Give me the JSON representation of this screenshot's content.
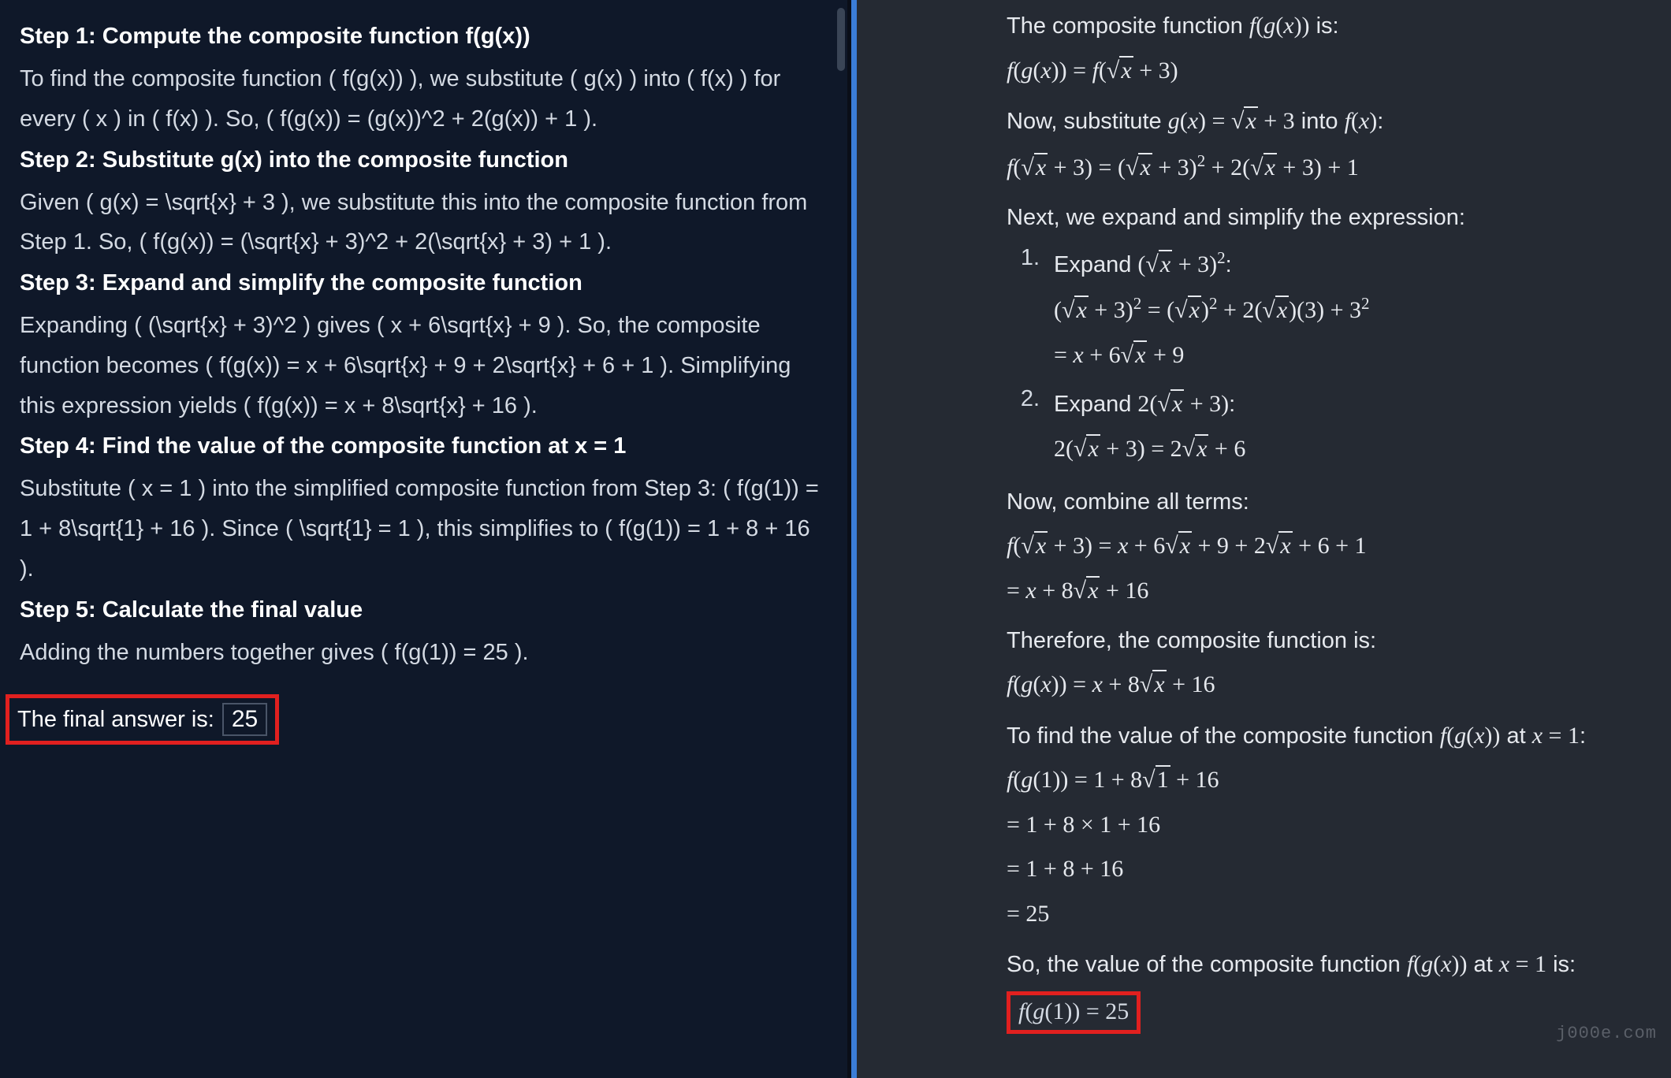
{
  "left": {
    "steps": [
      {
        "title": "Step 1: Compute the composite function f(g(x))",
        "body": "To find the composite function ( f(g(x)) ), we substitute ( g(x) ) into ( f(x) ) for every ( x ) in ( f(x) ). So, ( f(g(x)) = (g(x))^2 + 2(g(x)) + 1 )."
      },
      {
        "title": "Step 2: Substitute g(x) into the composite function",
        "body": "Given ( g(x) = \\sqrt{x} + 3 ), we substitute this into the composite function from Step 1. So, ( f(g(x)) = (\\sqrt{x} + 3)^2 + 2(\\sqrt{x} + 3) + 1 )."
      },
      {
        "title": "Step 3: Expand and simplify the composite function",
        "body": "Expanding ( (\\sqrt{x} + 3)^2 ) gives ( x + 6\\sqrt{x} + 9 ). So, the composite function becomes ( f(g(x)) = x + 6\\sqrt{x} + 9 + 2\\sqrt{x} + 6 + 1 ). Simplifying this expression yields ( f(g(x)) = x + 8\\sqrt{x} + 16 )."
      },
      {
        "title": "Step 4: Find the value of the composite function at x = 1",
        "body": "Substitute ( x = 1 ) into the simplified composite function from Step 3: ( f(g(1)) = 1 + 8\\sqrt{1} + 16 ). Since ( \\sqrt{1} = 1 ), this simplifies to ( f(g(1)) = 1 + 8 + 16 )."
      },
      {
        "title": "Step 5: Calculate the final value",
        "body": "Adding the numbers together gives ( f(g(1)) = 25 )."
      }
    ],
    "final_label": "The final answer is:",
    "final_value": "25"
  },
  "right": {
    "intro": "The composite function f(g(x)) is:",
    "eq1": "f(g(x)) = f(√x + 3)",
    "sub_text": "Now, substitute g(x) = √x + 3 into f(x):",
    "eq2": "f(√x + 3) = (√x + 3)² + 2(√x + 3) + 1",
    "expand_text": "Next, we expand and simplify the expression:",
    "item1_label": "Expand (√x + 3)²:",
    "item1_line1": "(√x + 3)² = (√x)² + 2(√x)(3) + 3²",
    "item1_line2": "= x + 6√x + 9",
    "item2_label": "Expand 2(√x + 3):",
    "item2_line1": "2(√x + 3) = 2√x + 6",
    "combine_text": "Now, combine all terms:",
    "combine_line1": "f(√x + 3) = x + 6√x + 9 + 2√x + 6 + 1",
    "combine_line2": "= x + 8√x + 16",
    "therefore_text": "Therefore, the composite function is:",
    "therefore_eq": "f(g(x)) = x + 8√x + 16",
    "find_text": "To find the value of the composite function f(g(x)) at x = 1:",
    "calc1": "f(g(1)) = 1 + 8√1 + 16",
    "calc2": "= 1 + 8 × 1 + 16",
    "calc3": "= 1 + 8 + 16",
    "calc4": "= 25",
    "so_text": "So, the value of the composite function f(g(x)) at x = 1 is:",
    "final_eq": "f(g(1)) = 25",
    "list_num1": "1.",
    "list_num2": "2."
  },
  "watermark": "j000e.com"
}
